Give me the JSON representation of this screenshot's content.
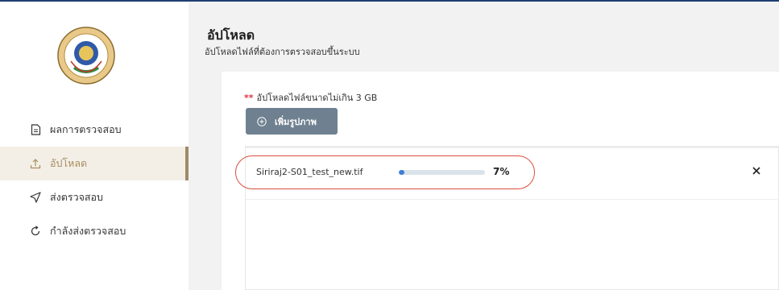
{
  "colors": {
    "top_line": "#1f3f73",
    "active_text": "#a88e5e",
    "active_bar": "#a08b66",
    "button_bg": "#6f8190",
    "required_star": "#e0323e",
    "progress_fill": "#3d7fd6",
    "annotation_outline": "#d9503c"
  },
  "sidebar": {
    "logo_icon": "siriraj-emblem-icon",
    "items": [
      {
        "label": "ผลการตรวจสอบ",
        "icon": "document-icon"
      },
      {
        "label": "อัปโหลด",
        "icon": "upload-icon"
      },
      {
        "label": "ส่งตรวจสอบ",
        "icon": "send-icon"
      },
      {
        "label": "กำลังส่งตรวจสอบ",
        "icon": "refresh-icon"
      }
    ],
    "active_index": 1
  },
  "header": {
    "title": "อัปโหลด",
    "subtitle": "อัปโหลดไฟล์ที่ต้องการตรวจสอบขึ้นระบบ"
  },
  "upload": {
    "required_mark": "**",
    "limit_text": "อัปโหลดไฟล์ขนาดไม่เกิน 3 GB",
    "add_button": "เพิ่มรูปภาพ",
    "files": [
      {
        "name": "Siriraj2-S01_test_new.tif",
        "progress": 7,
        "progress_label": "7%"
      }
    ]
  }
}
